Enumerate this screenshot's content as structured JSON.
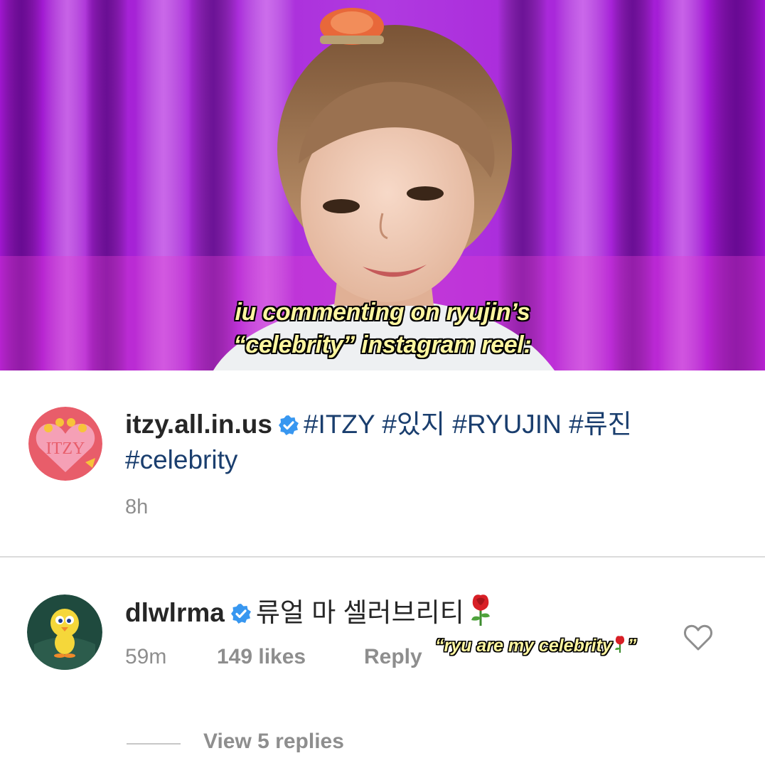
{
  "caption": {
    "line1": "iu commenting on ryujin’s",
    "line2": "“celebrity” instagram reel:"
  },
  "post": {
    "username": "itzy.all.in.us",
    "hashtags_line1": "#ITZY #있지 #RYUJIN #류진",
    "hashtags_line2": "#celebrity",
    "time": "8h",
    "avatar_text": "ITZY"
  },
  "comment": {
    "username": "dlwlrma",
    "text": "류얼 마 셀러브리티",
    "emoji": "rose",
    "time": "59m",
    "likes": "149 likes",
    "reply_label": "Reply",
    "translation": "“ryu are my celebrity",
    "translation_close": "”",
    "view_replies": "View 5 replies"
  },
  "icons": {
    "verified": "verified-badge-icon",
    "like": "heart-icon",
    "rose": "rose-emoji"
  },
  "colors": {
    "verified_blue": "#3897f0",
    "hashtag": "#1a3e6e",
    "caption_yellow": "#fff6a0",
    "curtain": "#a41ad6"
  }
}
